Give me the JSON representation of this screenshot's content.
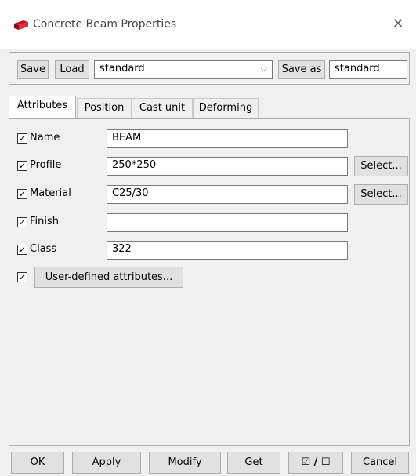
{
  "window": {
    "title": "Concrete Beam Properties"
  },
  "presets": {
    "save_label": "Save",
    "load_label": "Load",
    "load_selected": "standard",
    "save_as_label": "Save as",
    "save_as_value": "standard"
  },
  "tabs": [
    {
      "label": "Attributes"
    },
    {
      "label": "Position"
    },
    {
      "label": "Cast unit"
    },
    {
      "label": "Deforming"
    }
  ],
  "attributes": {
    "name": {
      "label": "Name",
      "value": "BEAM"
    },
    "profile": {
      "label": "Profile",
      "value": "250*250",
      "button": "Select..."
    },
    "material": {
      "label": "Material",
      "value": "C25/30",
      "button": "Select..."
    },
    "finish": {
      "label": "Finish",
      "value": ""
    },
    "class": {
      "label": "Class",
      "value": "322"
    },
    "user_defined": "User-defined attributes..."
  },
  "footer": {
    "ok": "OK",
    "apply": "Apply",
    "modify": "Modify",
    "get": "Get",
    "toggle": "☑ / ☐",
    "cancel": "Cancel"
  },
  "colors": {
    "brand": "#c8102e",
    "accent": "#d94b3b"
  }
}
